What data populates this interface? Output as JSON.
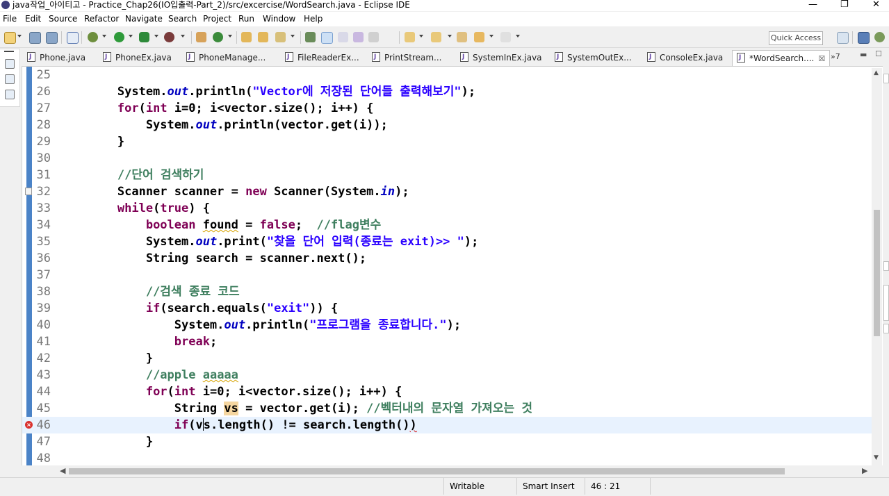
{
  "window": {
    "title": "java작업_아이티고 - Practice_Chap26(IO입출력-Part_2)/src/excercise/WordSearch.java - Eclipse IDE",
    "minimize_glyph": "—",
    "restore_glyph": "❐",
    "close_glyph": "✕"
  },
  "menu": [
    "File",
    "Edit",
    "Source",
    "Refactor",
    "Navigate",
    "Search",
    "Project",
    "Run",
    "Window",
    "Help"
  ],
  "quick_access": "Quick Access",
  "tabs": [
    {
      "label": "Phone.java"
    },
    {
      "label": "PhoneEx.java"
    },
    {
      "label": "PhoneManage..."
    },
    {
      "label": "FileReaderEx..."
    },
    {
      "label": "PrintStream..."
    },
    {
      "label": "SystemInEx.java"
    },
    {
      "label": "SystemOutEx..."
    },
    {
      "label": "ConsoleEx.java"
    },
    {
      "label": "*WordSearch....",
      "active": true
    }
  ],
  "tab_close": "☒",
  "tab_overflow": "»7",
  "code_lines": [
    {
      "num": "25",
      "text": ""
    },
    {
      "num": "26",
      "text": "        System.out.println(\"Vector에 저장된 단어들 출력해보기\");"
    },
    {
      "num": "27",
      "text": "        for(int i=0; i<vector.size(); i++) {"
    },
    {
      "num": "28",
      "text": "            System.out.println(vector.get(i));"
    },
    {
      "num": "29",
      "text": "        }"
    },
    {
      "num": "30",
      "text": ""
    },
    {
      "num": "31",
      "text": "        //단어 검색하기"
    },
    {
      "num": "32",
      "text": "        Scanner scanner = new Scanner(System.in);"
    },
    {
      "num": "33",
      "text": "        while(true) {"
    },
    {
      "num": "34",
      "text": "            boolean found = false;  //flag변수"
    },
    {
      "num": "35",
      "text": "            System.out.print(\"찾을 단어 입력(종료는 exit)>> \");"
    },
    {
      "num": "36",
      "text": "            String search = scanner.next();"
    },
    {
      "num": "37",
      "text": ""
    },
    {
      "num": "38",
      "text": "            //검색 종료 코드"
    },
    {
      "num": "39",
      "text": "            if(search.equals(\"exit\")) {"
    },
    {
      "num": "40",
      "text": "                System.out.println(\"프로그램을 종료합니다.\");"
    },
    {
      "num": "41",
      "text": "                break;"
    },
    {
      "num": "42",
      "text": "            }"
    },
    {
      "num": "43",
      "text": "            //apple aaaaa"
    },
    {
      "num": "44",
      "text": "            for(int i=0; i<vector.size(); i++) {"
    },
    {
      "num": "45",
      "text": "                String vs = vector.get(i); //벡터내의 문자열 가져오는 것"
    },
    {
      "num": "46",
      "text": "                if(vs.length() != search.length())"
    },
    {
      "num": "47",
      "text": "            }"
    },
    {
      "num": "48",
      "text": ""
    }
  ],
  "current_line": "46",
  "error_line": "46",
  "status": {
    "writable": "Writable",
    "insert_mode": "Smart Insert",
    "position": "46 : 21"
  },
  "colors": {
    "keyword": "#7f0055",
    "string": "#2a00ff",
    "comment": "#3f7f5f",
    "field": "#0000c0",
    "current_line_bg": "#e8f2fe",
    "occurrence_bg": "#f5d6a0"
  }
}
